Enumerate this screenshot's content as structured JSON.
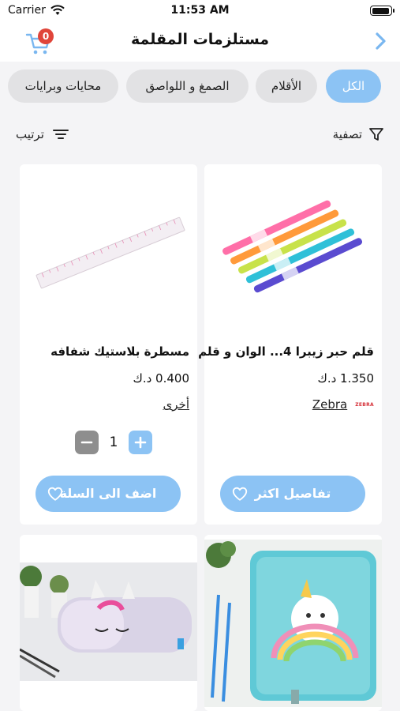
{
  "status": {
    "carrier": "Carrier",
    "time": "11:53 AM"
  },
  "header": {
    "title": "مستلزمات المقلمة",
    "cart_count": "0"
  },
  "chips": [
    {
      "label": "الكل",
      "active": true
    },
    {
      "label": "الأقلام",
      "active": false
    },
    {
      "label": "الصمغ و اللواصق",
      "active": false
    },
    {
      "label": "محايات وبرايات",
      "active": false
    }
  ],
  "toolbar": {
    "filter_label": "تصفية",
    "sort_label": "ترتيب"
  },
  "products": [
    {
      "name": "قلم حبر زيبرا 4... الوان و قلم",
      "price": "1.350 د.ك",
      "brand": "Zebra",
      "brand_logo": "ZEBRA",
      "action_label": "تفاصيل اكثر"
    },
    {
      "name": "مسطرة بلاستيك شفافه",
      "price": "0.400 د.ك",
      "brand": "أخرى",
      "quantity": "1",
      "action_label": "اضف الى السلة"
    }
  ],
  "colors": {
    "accent": "#8cc3f4",
    "badge": "#e0453a",
    "back_arrow": "#7ab7f0"
  },
  "icons": [
    "wifi-icon",
    "battery-icon",
    "back-arrow-icon",
    "cart-icon",
    "filter-icon",
    "sort-icon",
    "heart-icon",
    "plus-icon",
    "minus-icon"
  ]
}
